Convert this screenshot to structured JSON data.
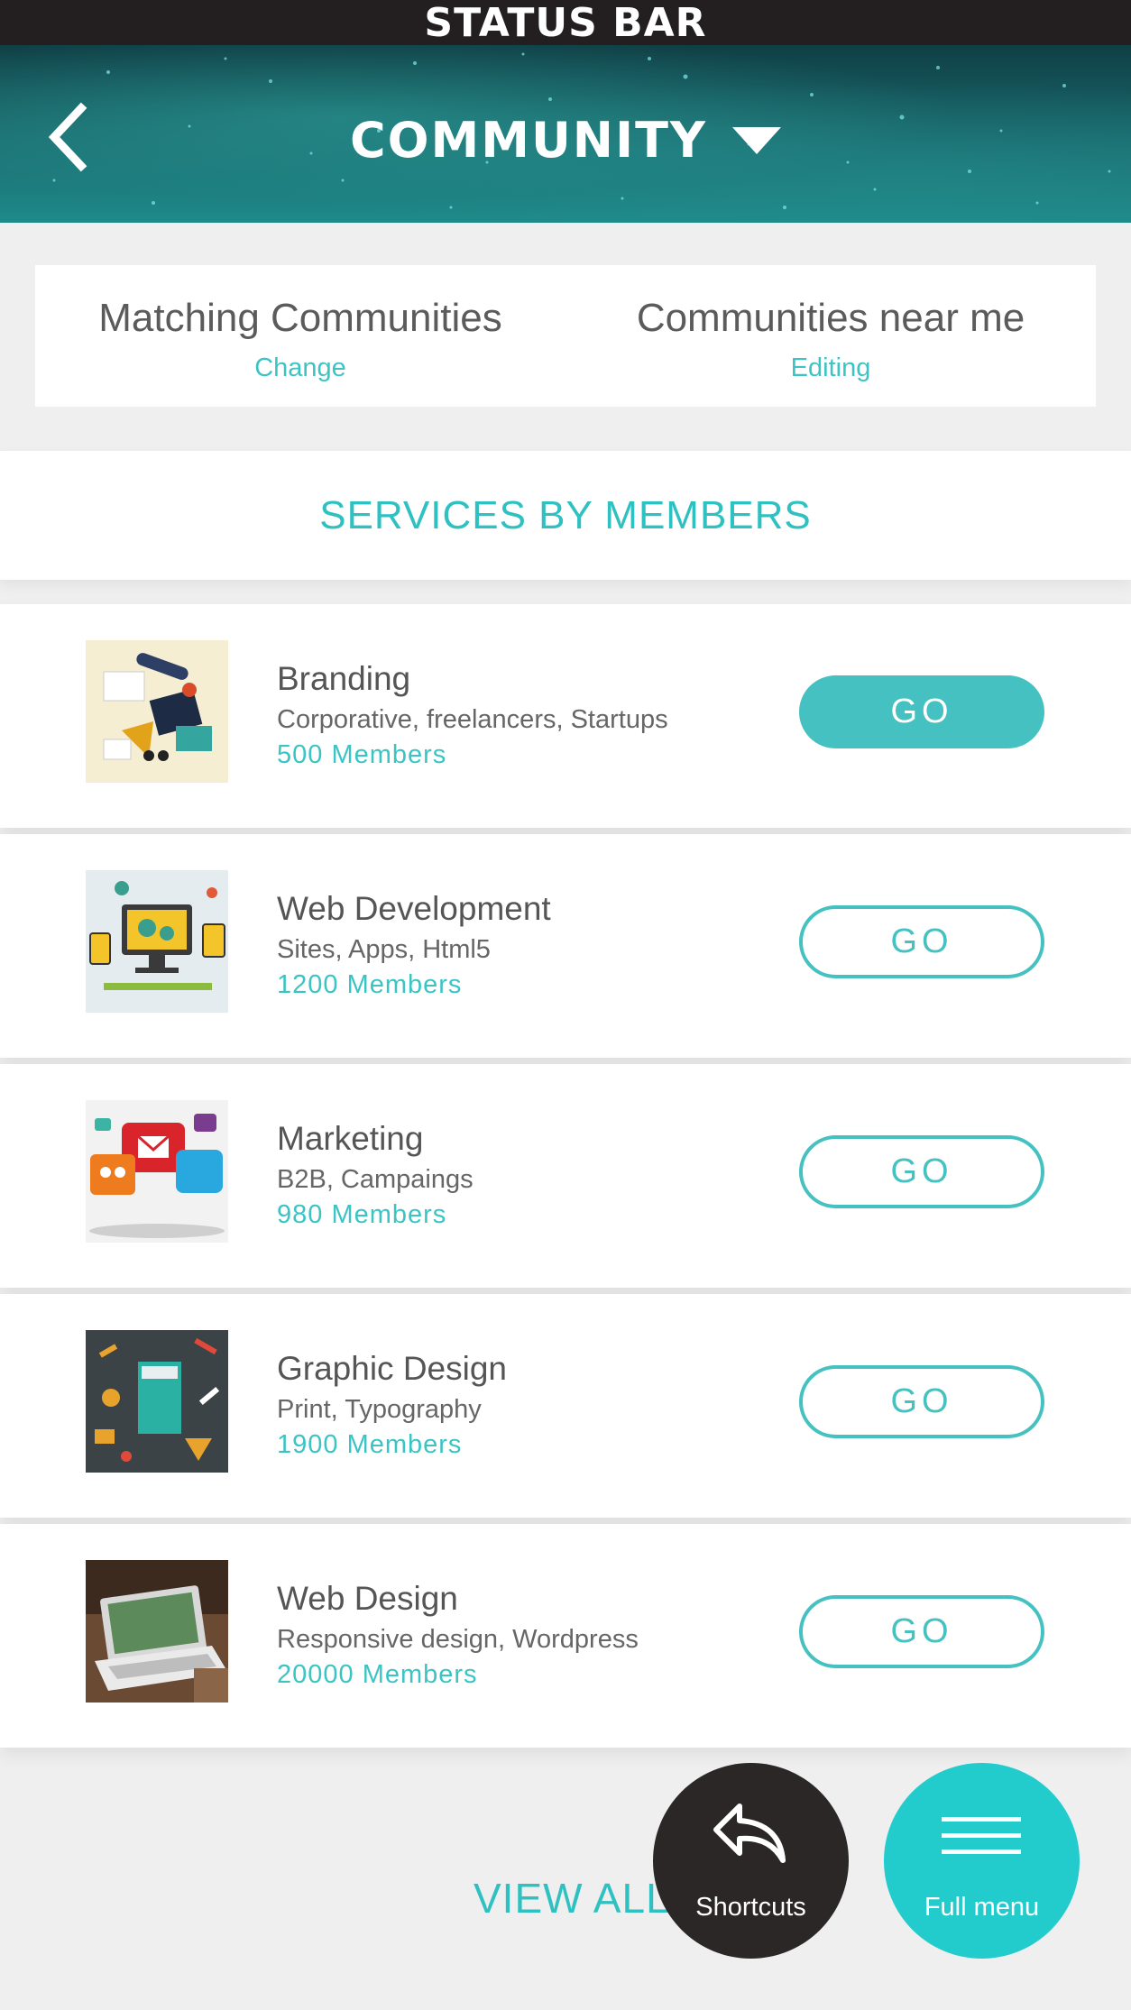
{
  "status_bar": {
    "label": "STATUS BAR"
  },
  "header": {
    "title": "COMMUNITY",
    "back_icon": "chevron-left-icon",
    "dropdown_icon": "caret-down-icon"
  },
  "filters": [
    {
      "title": "Matching Communities",
      "link": "Change"
    },
    {
      "title": "Communities near me",
      "link": "Editing"
    }
  ],
  "section": {
    "title": "SERVICES BY MEMBERS"
  },
  "communities": [
    {
      "title": "Branding",
      "subtitle": "Corporative, freelancers, Startups",
      "members": "500 Members",
      "button": "GO",
      "selected": true
    },
    {
      "title": "Web Development",
      "subtitle": "Sites, Apps, Html5",
      "members": "1200 Members",
      "button": "GO",
      "selected": false
    },
    {
      "title": "Marketing",
      "subtitle": "B2B, Campaings",
      "members": "980 Members",
      "button": "GO",
      "selected": false
    },
    {
      "title": "Graphic Design",
      "subtitle": "Print, Typography",
      "members": "1900 Members",
      "button": "GO",
      "selected": false
    },
    {
      "title": "Web Design",
      "subtitle": "Responsive design, Wordpress",
      "members": "20000 Members",
      "button": "GO",
      "selected": false
    }
  ],
  "footer": {
    "view_all": "VIEW ALL",
    "shortcuts_label": "Shortcuts",
    "menu_label": "Full menu"
  },
  "colors": {
    "accent": "#45c1c1",
    "accent_bright": "#23cccc",
    "dark": "#231f20",
    "text": "#5b5b5b"
  }
}
